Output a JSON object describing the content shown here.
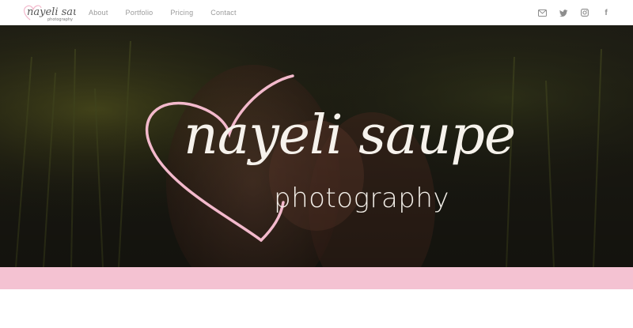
{
  "brand": {
    "logo_text": "nayeli saupe",
    "logo_subtext": "photography"
  },
  "nav": {
    "items": [
      {
        "label": "About"
      },
      {
        "label": "Portfolio"
      },
      {
        "label": "Pricing"
      },
      {
        "label": "Contact"
      }
    ]
  },
  "social": {
    "icons": [
      "envelope-icon",
      "twitter-icon",
      "instagram-icon",
      "facebook-icon"
    ],
    "facebook_glyph": "f"
  },
  "hero": {
    "title": "nayeli saupe",
    "subtitle": "photography"
  },
  "colors": {
    "accent_pink": "#f4c2d2",
    "heart_stroke": "#f3b9cc",
    "nav_text": "#9a9a9a",
    "hero_text": "#f6f2ec"
  }
}
